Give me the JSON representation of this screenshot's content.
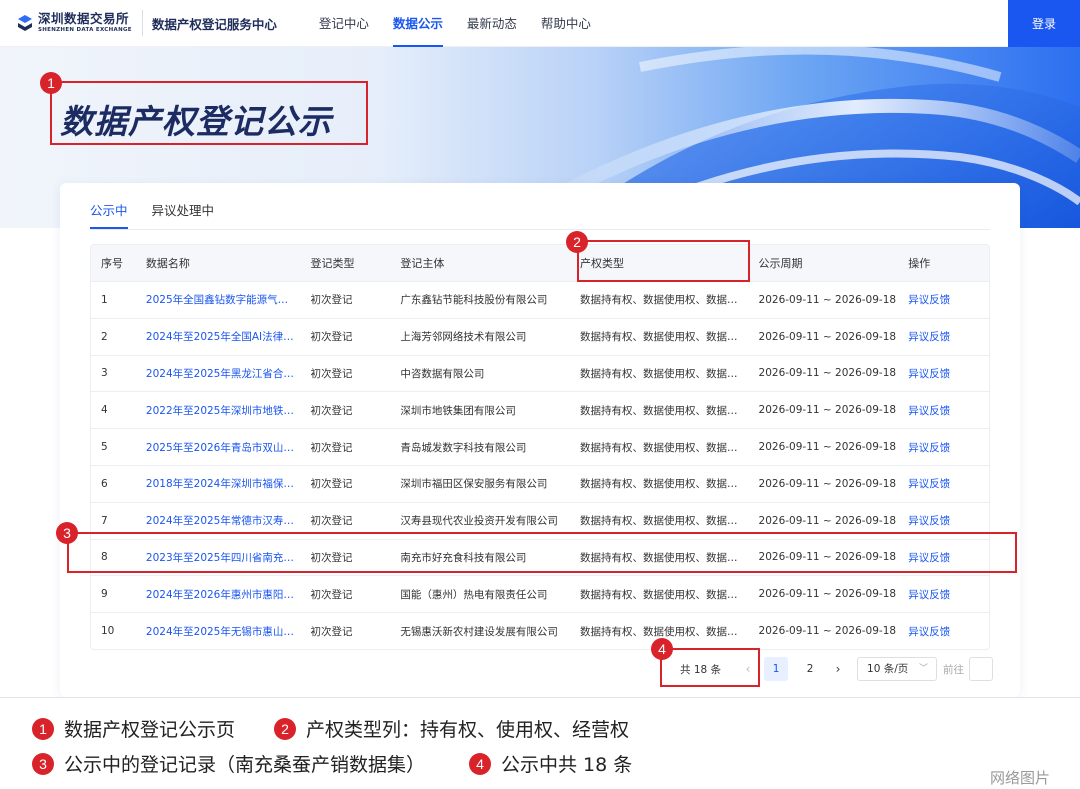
{
  "header": {
    "logo_cn": "深圳数据交易所",
    "logo_en": "SHENZHEN DATA EXCHANGE",
    "center_name": "数据产权登记服务中心",
    "nav": [
      "登记中心",
      "数据公示",
      "最新动态",
      "帮助中心"
    ],
    "active_nav": "数据公示",
    "login_label": "登录",
    "accent_color": "#1a56f0"
  },
  "banner": {
    "title": "数据产权登记公示"
  },
  "tabs": [
    "公示中",
    "异议处理中"
  ],
  "table": {
    "columns": [
      "序号",
      "数据名称",
      "登记类型",
      "登记主体",
      "产权类型",
      "公示周期",
      "操作"
    ],
    "rows": [
      [
        "1",
        "2025年全国鑫钻数字能源气…",
        "初次登记",
        "广东鑫钻节能科技股份有限公司",
        "数据持有权、数据使用权、数据…",
        "2026-09-11 ~ 2026-09-18",
        "异议反馈"
      ],
      [
        "2",
        "2024年至2025年全国AI法律…",
        "初次登记",
        "上海芳邻网络技术有限公司",
        "数据持有权、数据使用权、数据…",
        "2026-09-11 ~ 2026-09-18",
        "异议反馈"
      ],
      [
        "3",
        "2024年至2025年黑龙江省合…",
        "初次登记",
        "中咨数据有限公司",
        "数据持有权、数据使用权、数据…",
        "2026-09-11 ~ 2026-09-18",
        "异议反馈"
      ],
      [
        "4",
        "2022年至2025年深圳市地铁…",
        "初次登记",
        "深圳市地铁集团有限公司",
        "数据持有权、数据使用权、数据…",
        "2026-09-11 ~ 2026-09-18",
        "异议反馈"
      ],
      [
        "5",
        "2025年至2026年青岛市双山…",
        "初次登记",
        "青岛城发数字科技有限公司",
        "数据持有权、数据使用权、数据…",
        "2026-09-11 ~ 2026-09-18",
        "异议反馈"
      ],
      [
        "6",
        "2018年至2024年深圳市福保…",
        "初次登记",
        "深圳市福田区保安服务有限公司",
        "数据持有权、数据使用权、数据…",
        "2026-09-11 ~ 2026-09-18",
        "异议反馈"
      ],
      [
        "7",
        "2024年至2025年常德市汉寿…",
        "初次登记",
        "汉寿县现代农业投资开发有限公司",
        "数据持有权、数据使用权、数据…",
        "2026-09-11 ~ 2026-09-18",
        "异议反馈"
      ],
      [
        "8",
        "2023年至2025年四川省南充…",
        "初次登记",
        "南充市好充食科技有限公司",
        "数据持有权、数据使用权、数据…",
        "2026-09-11 ~ 2026-09-18",
        "异议反馈"
      ],
      [
        "9",
        "2024年至2026年惠州市惠阳…",
        "初次登记",
        "国能（惠州）热电有限责任公司",
        "数据持有权、数据使用权、数据…",
        "2026-09-11 ~ 2026-09-18",
        "异议反馈"
      ],
      [
        "10",
        "2024年至2025年无锡市惠山…",
        "初次登记",
        "无锡惠沃新农村建设发展有限公司",
        "数据持有权、数据使用权、数据…",
        "2026-09-11 ~ 2026-09-18",
        "异议反馈"
      ]
    ]
  },
  "pagination": {
    "total": "共 18 条",
    "prev": "‹",
    "pages": [
      "1",
      "2"
    ],
    "current": "1",
    "next": "›",
    "page_size": "10 条/页",
    "goto": "前往"
  },
  "annotations": {
    "color": "#d9232a",
    "numbers": [
      "1",
      "2",
      "3",
      "4"
    ],
    "legend": [
      {
        "num": "1",
        "text": "数据产权登记公示页"
      },
      {
        "num": "2",
        "text": "产权类型列：持有权、使用权、经营权"
      },
      {
        "num": "3",
        "text": "公示中的登记记录（南充桑蚕产销数据集）"
      },
      {
        "num": "4",
        "text": "公示中共 18 条"
      }
    ]
  },
  "watermark": "网络图片"
}
